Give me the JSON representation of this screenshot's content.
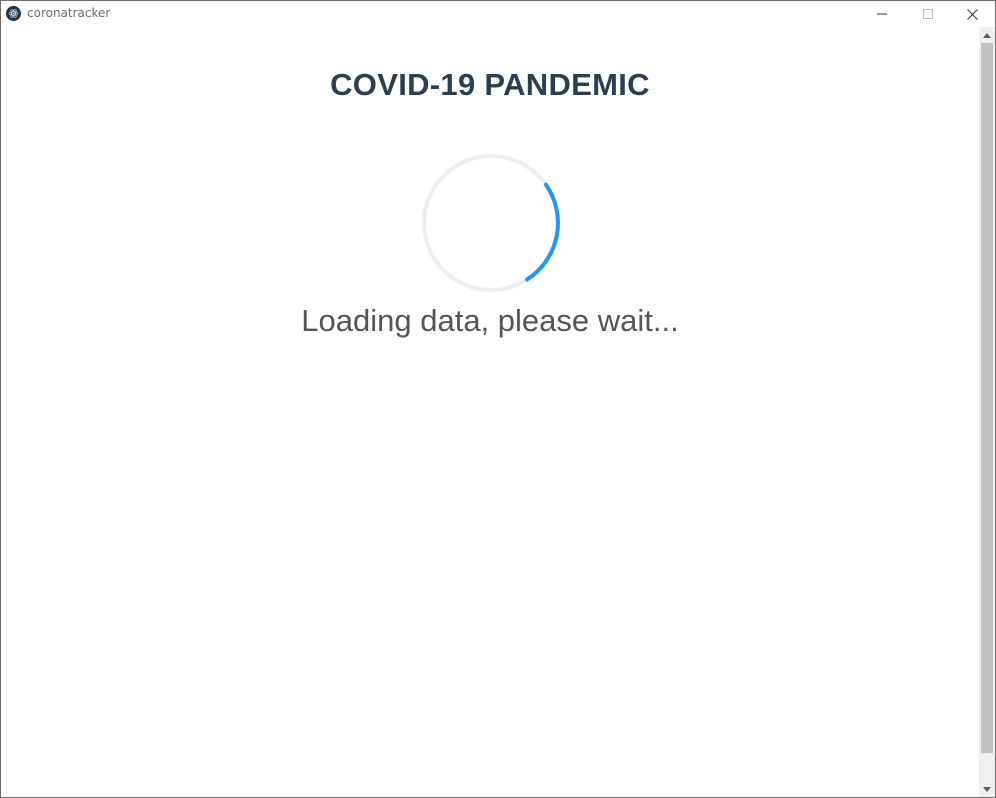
{
  "window": {
    "title": "coronatracker",
    "icon": "electron-atom-icon",
    "controls": {
      "minimize": "minimize-icon",
      "maximize": "maximize-icon",
      "close": "close-icon"
    }
  },
  "main": {
    "heading": "COVID-19 PANDEMIC",
    "loading_text": "Loading data, please wait...",
    "spinner": {
      "track_color": "#eeeeee",
      "arc_color": "#2196f3"
    }
  },
  "colors": {
    "heading": "#2c3e50",
    "loading_text": "#555555",
    "scroll_thumb": "#c1c1c1"
  }
}
